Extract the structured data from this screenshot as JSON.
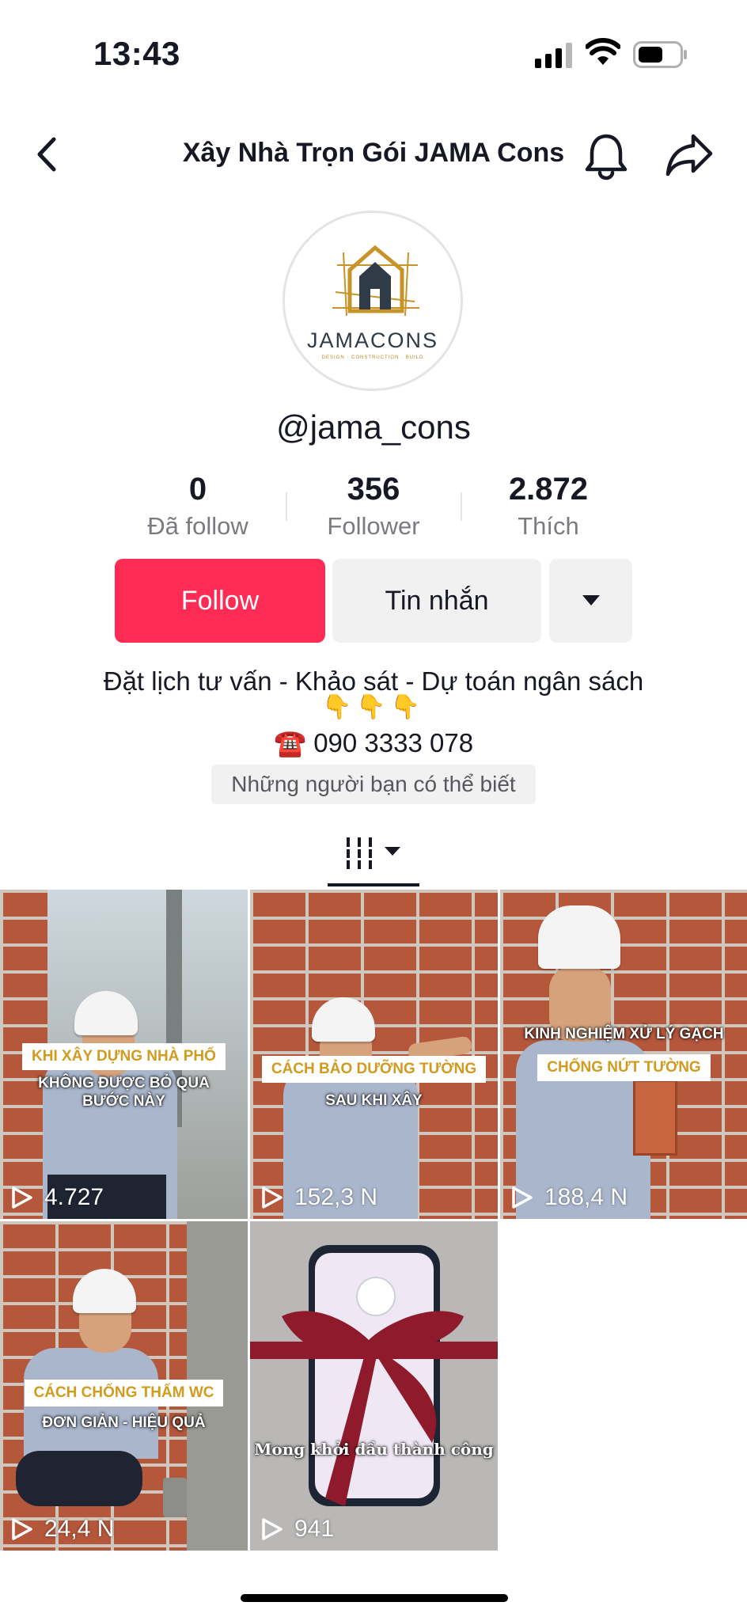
{
  "status_bar": {
    "time": "13:43"
  },
  "nav": {
    "title": "Xây Nhà Trọn Gói JAMA Cons"
  },
  "profile": {
    "logo_text": "JAMACONS",
    "logo_sub": "DESIGN · CONSTRUCTION · BUILD",
    "username": "@jama_cons",
    "stats": [
      {
        "value": "0",
        "label": "Đã follow"
      },
      {
        "value": "356",
        "label": "Follower"
      },
      {
        "value": "2.872",
        "label": "Thích"
      }
    ],
    "buttons": {
      "follow": "Follow",
      "message": "Tin nhắn"
    },
    "bio_line1": "Đặt lịch tư vấn - Khảo sát - Dự toán ngân sách",
    "bio_line2": "👇👇👇",
    "bio_line3": "☎️ 090 3333 078",
    "suggest": "Những người bạn có thể biết"
  },
  "videos": [
    {
      "caption_box": "KHI XÂY DỰNG NHÀ PHỐ",
      "caption_white": "KHÔNG ĐƯỢC BỎ QUA BƯỚC NÀY",
      "views": "4.727"
    },
    {
      "caption_box": "CÁCH BẢO DƯỠNG TƯỜNG",
      "caption_white": "SAU KHI XÂY",
      "views": "152,3 N"
    },
    {
      "caption_white": "KINH NGHIỆM XỬ LÝ GẠCH",
      "caption_box": "CHỐNG NỨT TƯỜNG",
      "views": "188,4 N"
    },
    {
      "caption_box": "CÁCH CHỐNG THẤM WC",
      "caption_white": "ĐƠN GIẢN - HIỆU QUẢ",
      "views": "24,4 N"
    },
    {
      "caption_white": "Mong khởi đầu thành công",
      "views": "941"
    }
  ]
}
